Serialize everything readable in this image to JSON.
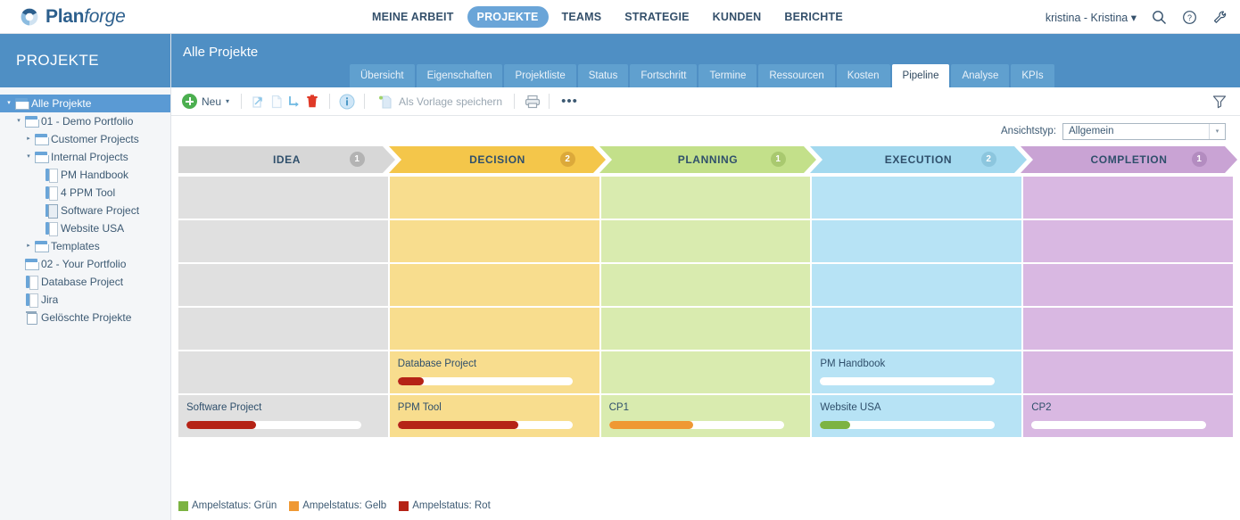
{
  "brand": {
    "name_bold": "Plan",
    "name_italic": "forge",
    "logo_icon": "planforge-swirl-icon",
    "accent": "#2c5f8d"
  },
  "topnav": {
    "items": [
      {
        "label": "MEINE ARBEIT",
        "active": false
      },
      {
        "label": "PROJEKTE",
        "active": true
      },
      {
        "label": "TEAMS",
        "active": false
      },
      {
        "label": "STRATEGIE",
        "active": false
      },
      {
        "label": "KUNDEN",
        "active": false
      },
      {
        "label": "BERICHTE",
        "active": false
      }
    ],
    "active_pill_color": "#6aa5d8"
  },
  "topright": {
    "user_label": "kristina - Kristina",
    "user_caret": "▾",
    "icons": [
      "search-icon",
      "help-icon",
      "settings-wrench-icon"
    ]
  },
  "sidebar": {
    "title": "PROJEKTE",
    "header_color": "#4f8fc4",
    "selected_color": "#5a9ad4",
    "items": [
      {
        "label": "Alle Projekte",
        "indent": 0,
        "twisty": "▾",
        "icon": "portfolio-icon",
        "selected": true
      },
      {
        "label": "01 - Demo Portfolio",
        "indent": 1,
        "twisty": "▾",
        "icon": "portfolio-icon",
        "selected": false
      },
      {
        "label": "Customer Projects",
        "indent": 2,
        "twisty": "▸",
        "icon": "portfolio-icon",
        "selected": false
      },
      {
        "label": "Internal Projects",
        "indent": 2,
        "twisty": "▾",
        "icon": "portfolio-icon",
        "selected": false
      },
      {
        "label": "PM Handbook",
        "indent": 3,
        "twisty": "",
        "icon": "project-icon",
        "selected": false
      },
      {
        "label": "4 PPM Tool",
        "indent": 3,
        "twisty": "",
        "icon": "project-icon",
        "selected": false
      },
      {
        "label": "Software Project",
        "indent": 3,
        "twisty": "",
        "icon": "software-project-icon",
        "selected": false
      },
      {
        "label": "Website USA",
        "indent": 3,
        "twisty": "",
        "icon": "project-icon",
        "selected": false
      },
      {
        "label": "Templates",
        "indent": 2,
        "twisty": "▸",
        "icon": "portfolio-icon",
        "selected": false
      },
      {
        "label": "02 - Your Portfolio",
        "indent": 1,
        "twisty": "",
        "icon": "portfolio-icon",
        "selected": false
      },
      {
        "label": "Database Project",
        "indent": 1,
        "twisty": "",
        "icon": "project-icon",
        "selected": false
      },
      {
        "label": "Jira",
        "indent": 1,
        "twisty": "",
        "icon": "project-icon",
        "selected": false
      },
      {
        "label": "Gelöschte Projekte",
        "indent": 1,
        "twisty": "",
        "icon": "trash-icon",
        "selected": false
      }
    ]
  },
  "content_header": {
    "title": "Alle Projekte",
    "tabs": [
      {
        "label": "Übersicht",
        "active": false
      },
      {
        "label": "Eigenschaften",
        "active": false
      },
      {
        "label": "Projektliste",
        "active": false
      },
      {
        "label": "Status",
        "active": false
      },
      {
        "label": "Fortschritt",
        "active": false
      },
      {
        "label": "Termine",
        "active": false
      },
      {
        "label": "Ressourcen",
        "active": false
      },
      {
        "label": "Kosten",
        "active": false
      },
      {
        "label": "Pipeline",
        "active": true
      },
      {
        "label": "Analyse",
        "active": false
      },
      {
        "label": "KPIs",
        "active": false
      }
    ]
  },
  "toolbar": {
    "new_label": "Neu",
    "new_caret": "▾",
    "new_icon": "plus-circle-icon",
    "template_label": "Als Vorlage speichern",
    "template_icon": "save-as-template-icon",
    "icons": [
      "move-project-icon",
      "copy-project-icon",
      "indent-project-icon",
      "delete-project-icon",
      "info-icon",
      "print-icon",
      "more-options-icon"
    ],
    "more_label": "•••",
    "filter_icon": "filter-funnel-icon"
  },
  "viewtype": {
    "label": "Ansichtstyp:",
    "value": "Allgemein",
    "caret": "▾"
  },
  "pipeline": {
    "stages": [
      {
        "name": "IDEA",
        "count": "1",
        "color": "#d7d7d7",
        "cell_color": "#e0e0e0",
        "badge_color": "#b3b3b3"
      },
      {
        "name": "DECISION",
        "count": "2",
        "color": "#f4c64a",
        "cell_color": "#f8dd8e",
        "badge_color": "#dca93a"
      },
      {
        "name": "PLANNING",
        "count": "1",
        "color": "#c3e08a",
        "cell_color": "#d9ebaf",
        "badge_color": "#a9c96f"
      },
      {
        "name": "EXECUTION",
        "count": "2",
        "color": "#a3d9ef",
        "cell_color": "#b7e3f5",
        "badge_color": "#8cc6de"
      },
      {
        "name": "COMPLETION",
        "count": "1",
        "color": "#c9a3d4",
        "cell_color": "#d9b8e2",
        "badge_color": "#b38cc0"
      }
    ],
    "rows": 6,
    "cards": [
      {
        "stage": 1,
        "row": 4,
        "title": "Database Project",
        "progress": 15,
        "status": "rot"
      },
      {
        "stage": 3,
        "row": 4,
        "title": "PM Handbook",
        "progress": 0,
        "status": "none"
      },
      {
        "stage": 0,
        "row": 5,
        "title": "Software Project",
        "progress": 40,
        "status": "rot"
      },
      {
        "stage": 1,
        "row": 5,
        "title": "PPM Tool",
        "progress": 69,
        "status": "rot"
      },
      {
        "stage": 2,
        "row": 5,
        "title": "CP1",
        "progress": 48,
        "status": "gelb"
      },
      {
        "stage": 3,
        "row": 5,
        "title": "Website USA",
        "progress": 17,
        "status": "gruen"
      },
      {
        "stage": 4,
        "row": 5,
        "title": "CP2",
        "progress": 0,
        "status": "none"
      }
    ]
  },
  "legend": {
    "items": [
      {
        "label": "Ampelstatus: Grün",
        "color": "#7cb342"
      },
      {
        "label": "Ampelstatus: Gelb",
        "color": "#ef9833"
      },
      {
        "label": "Ampelstatus: Rot",
        "color": "#b52316"
      }
    ]
  },
  "status_colors": {
    "gruen": "#7cb342",
    "gelb": "#ef9833",
    "rot": "#b52316",
    "none": "#ffffff"
  }
}
